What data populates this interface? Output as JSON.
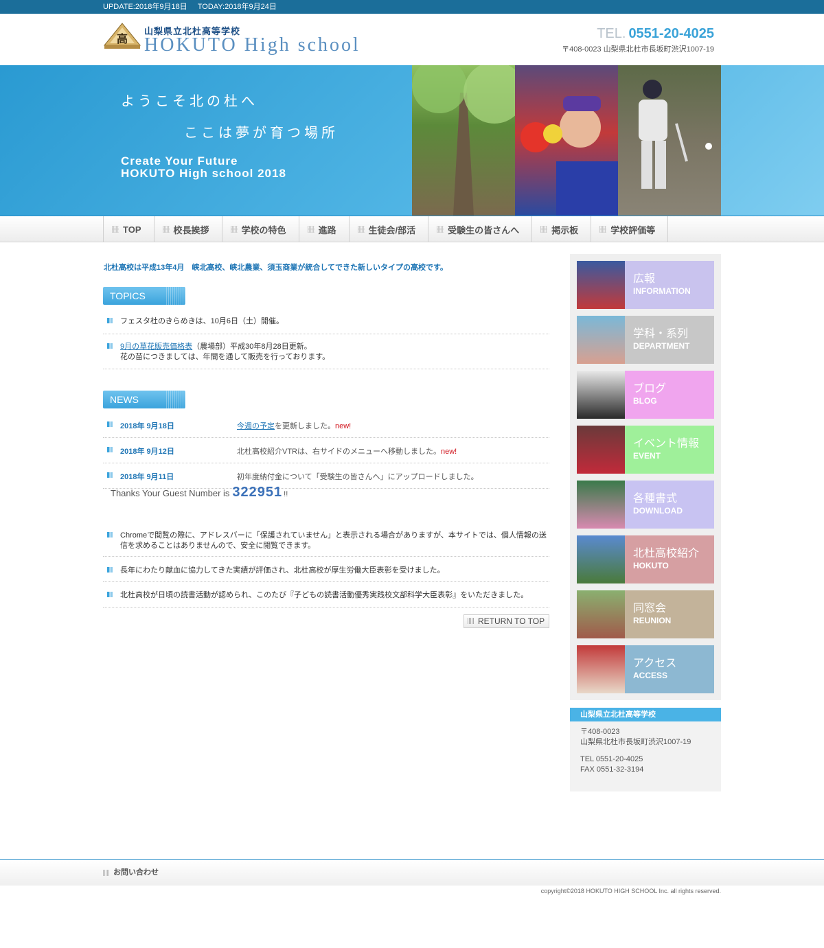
{
  "topbar": {
    "update": "UPDATE:2018年9月18日",
    "today": "TODAY:2018年9月24日"
  },
  "header": {
    "school_ja": "山梨県立北杜高等学校",
    "school_en": "HOKUTO High school",
    "tel_label": "TEL.",
    "tel": "0551-20-4025",
    "address": "〒408-0023 山梨県北杜市長坂町渋沢1007-19",
    "emblem_char": "高"
  },
  "hero": {
    "line1": "ようこそ北の杜へ",
    "line2": "ここは夢が育つ場所",
    "line3": "Create Your Future",
    "line4": "HOKUTO High school 2018"
  },
  "nav": [
    "TOP",
    "校長挨拶",
    "学校の特色",
    "進路",
    "生徒会/部活",
    "受験生の皆さんへ",
    "掲示板",
    "学校評価等"
  ],
  "intro": "北杜高校は平成13年4月　峡北高校、峡北農業、須玉商業が統合してできた新しいタイプの高校です。",
  "topics": {
    "heading": "TOPICS",
    "items": [
      {
        "text": "フェスタ杜のきらめきは、10月6日（土）開催。"
      },
      {
        "link": "9月の草花販売価格表",
        "text": "（農場部）平成30年8月28日更新。",
        "line2": "花の苗につきましては、年間を通して販売を行っております。"
      }
    ]
  },
  "news": {
    "heading": "NEWS",
    "items": [
      {
        "date": "2018年 9月18日",
        "link": "今週の予定",
        "text": "を更新しました。",
        "new": "new!"
      },
      {
        "date": "2018年 9月12日",
        "text": "北杜高校紹介VTRは、右サイドのメニューへ移動しました。",
        "new": "new!"
      },
      {
        "date": "2018年 9月11日",
        "text": "初年度納付金について「受験生の皆さんへ」にアップロードしました。"
      }
    ]
  },
  "guest": {
    "label": "Thanks Your Guest Number is",
    "number": "322951",
    "suffix": "!!"
  },
  "notices": [
    "Chromeで閲覧の際に、アドレスバーに「保護されていません」と表示される場合がありますが、本サイトでは、個人情報の送信を求めることはありませんので、安全に閲覧できます。",
    "長年にわたり献血に協力してきた実績が評価され、北杜高校が厚生労働大臣表彰を受けました。",
    "北杜高校が日頃の読書活動が認められ、このたび『子どもの読書活動優秀実践校文部科学大臣表彰』をいただきました。"
  ],
  "return_to_top": "RETURN TO TOP",
  "sidebar": [
    {
      "ja": "広報",
      "en": "INFORMATION",
      "color": "#c9c3ee"
    },
    {
      "ja": "学科・系列",
      "en": "DEPARTMENT",
      "color": "#c7c7c7"
    },
    {
      "ja": "ブログ",
      "en": "BLOG",
      "color": "#f0a5ee"
    },
    {
      "ja": "イベント情報",
      "en": "EVENT",
      "color": "#9ff09a"
    },
    {
      "ja": "各種書式",
      "en": "DOWNLOAD",
      "color": "#c8c3f2"
    },
    {
      "ja": "北杜高校紹介",
      "en": "HOKUTO",
      "color": "#d69fa2"
    },
    {
      "ja": "同窓会",
      "en": "REUNION",
      "color": "#c3b39a"
    },
    {
      "ja": "アクセス",
      "en": "ACCESS",
      "color": "#8db8d2"
    }
  ],
  "contact_box": {
    "title": "山梨県立北杜高等学校",
    "postal": "〒408-0023",
    "address": "山梨県北杜市長坂町渋沢1007-19",
    "tel": "TEL 0551-20-4025",
    "fax": "FAX 0551-32-3194"
  },
  "footer": {
    "link": "お問い合わせ",
    "copyright": "copyright©2018 HOKUTO HIGH SCHOOL Inc. all rights reserved."
  }
}
